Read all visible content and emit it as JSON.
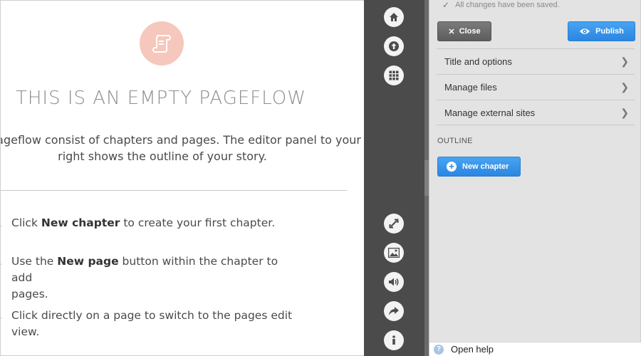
{
  "preview": {
    "title": "THIS IS AN EMPTY PAGEFLOW",
    "intro_line1": "h Pageflow consist of chapters and pages. The editor panel to your",
    "intro_line2": "right shows the outline of your story.",
    "steps": [
      {
        "num": ".",
        "pre": "Click ",
        "bold": "New chapter",
        "post": " to create your first chapter."
      },
      {
        "num": ".",
        "pre": "Use the ",
        "bold": "New page",
        "post": " button within the chapter to add",
        "post2": "pages."
      },
      {
        "num": ".",
        "pre": "Click directly on a page to switch to the pages edit view.",
        "bold": "",
        "post": ""
      }
    ]
  },
  "toolbar": {
    "icons": [
      "home-icon",
      "upload-icon",
      "grid-icon",
      "expand-icon",
      "image-icon",
      "volume-icon",
      "share-icon",
      "info-icon"
    ]
  },
  "panel": {
    "save_status": "All changes have been saved.",
    "close_label": "Close",
    "publish_label": "Publish",
    "nav": {
      "title_options": "Title and options",
      "manage_files": "Manage files",
      "manage_sites": "Manage external sites"
    },
    "outline_label": "OUTLINE",
    "new_chapter_label": "New chapter",
    "help_label": "Open help"
  },
  "colors": {
    "accent_blue": "#2a86e0",
    "toolbar_dark": "#4b4b4b",
    "logo_pink": "#f6c7bc",
    "panel_bg": "#e3e3e3"
  }
}
